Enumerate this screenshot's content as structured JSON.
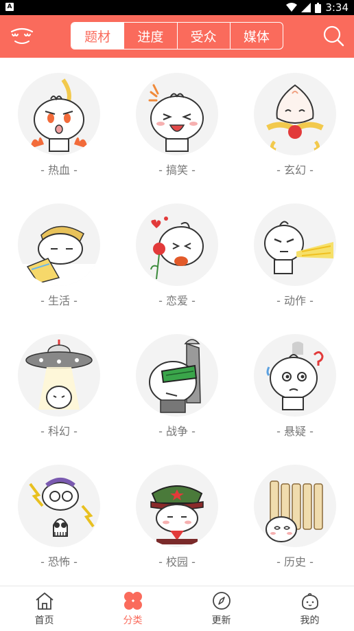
{
  "status_bar": {
    "time": "3:34",
    "app_badge": "A"
  },
  "header": {
    "tabs": [
      {
        "label": "题材",
        "active": true
      },
      {
        "label": "进度",
        "active": false
      },
      {
        "label": "受众",
        "active": false
      },
      {
        "label": "媒体",
        "active": false
      }
    ],
    "accent_color": "#fa6b5c"
  },
  "categories": [
    {
      "label": "- 热血 -",
      "icon": "hot-blood-icon"
    },
    {
      "label": "- 搞笑 -",
      "icon": "funny-icon"
    },
    {
      "label": "- 玄幻 -",
      "icon": "fantasy-icon"
    },
    {
      "label": "- 生活 -",
      "icon": "life-icon"
    },
    {
      "label": "- 恋爱 -",
      "icon": "romance-icon"
    },
    {
      "label": "- 动作 -",
      "icon": "action-icon"
    },
    {
      "label": "- 科幻 -",
      "icon": "scifi-icon"
    },
    {
      "label": "- 战争 -",
      "icon": "war-icon"
    },
    {
      "label": "- 悬疑 -",
      "icon": "mystery-icon"
    },
    {
      "label": "- 恐怖 -",
      "icon": "horror-icon"
    },
    {
      "label": "- 校园 -",
      "icon": "campus-icon"
    },
    {
      "label": "- 历史 -",
      "icon": "history-icon"
    }
  ],
  "bottom_nav": [
    {
      "label": "首页",
      "icon": "home-icon",
      "active": false
    },
    {
      "label": "分类",
      "icon": "category-icon",
      "active": true
    },
    {
      "label": "更新",
      "icon": "compass-icon",
      "active": false
    },
    {
      "label": "我的",
      "icon": "profile-icon",
      "active": false
    }
  ]
}
